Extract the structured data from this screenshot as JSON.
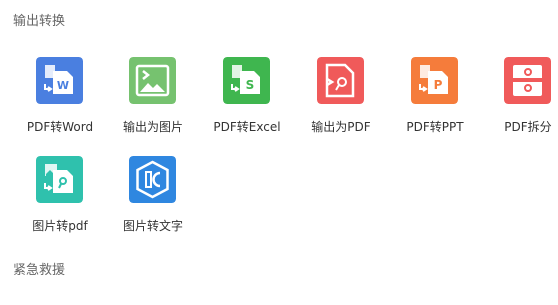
{
  "sections": [
    {
      "title": "输出转换",
      "tools": [
        {
          "label": "PDF转Word",
          "icon": "pdf-to-word-icon",
          "color": "#4a7fe0"
        },
        {
          "label": "输出为图片",
          "icon": "export-to-image-icon",
          "color": "#76c26f"
        },
        {
          "label": "PDF转Excel",
          "icon": "pdf-to-excel-icon",
          "color": "#3fb64f"
        },
        {
          "label": "输出为PDF",
          "icon": "export-to-pdf-icon",
          "color": "#f05a5a"
        },
        {
          "label": "PDF转PPT",
          "icon": "pdf-to-ppt-icon",
          "color": "#f57c3b"
        },
        {
          "label": "PDF拆分",
          "icon": "pdf-split-icon",
          "color": "#f05a5a"
        },
        {
          "label": "图片转pdf",
          "icon": "image-to-pdf-icon",
          "color": "#2fc1ad"
        },
        {
          "label": "图片转文字",
          "icon": "image-to-text-icon",
          "color": "#2f87e0"
        }
      ]
    },
    {
      "title": "紧急救援",
      "tools": []
    }
  ]
}
